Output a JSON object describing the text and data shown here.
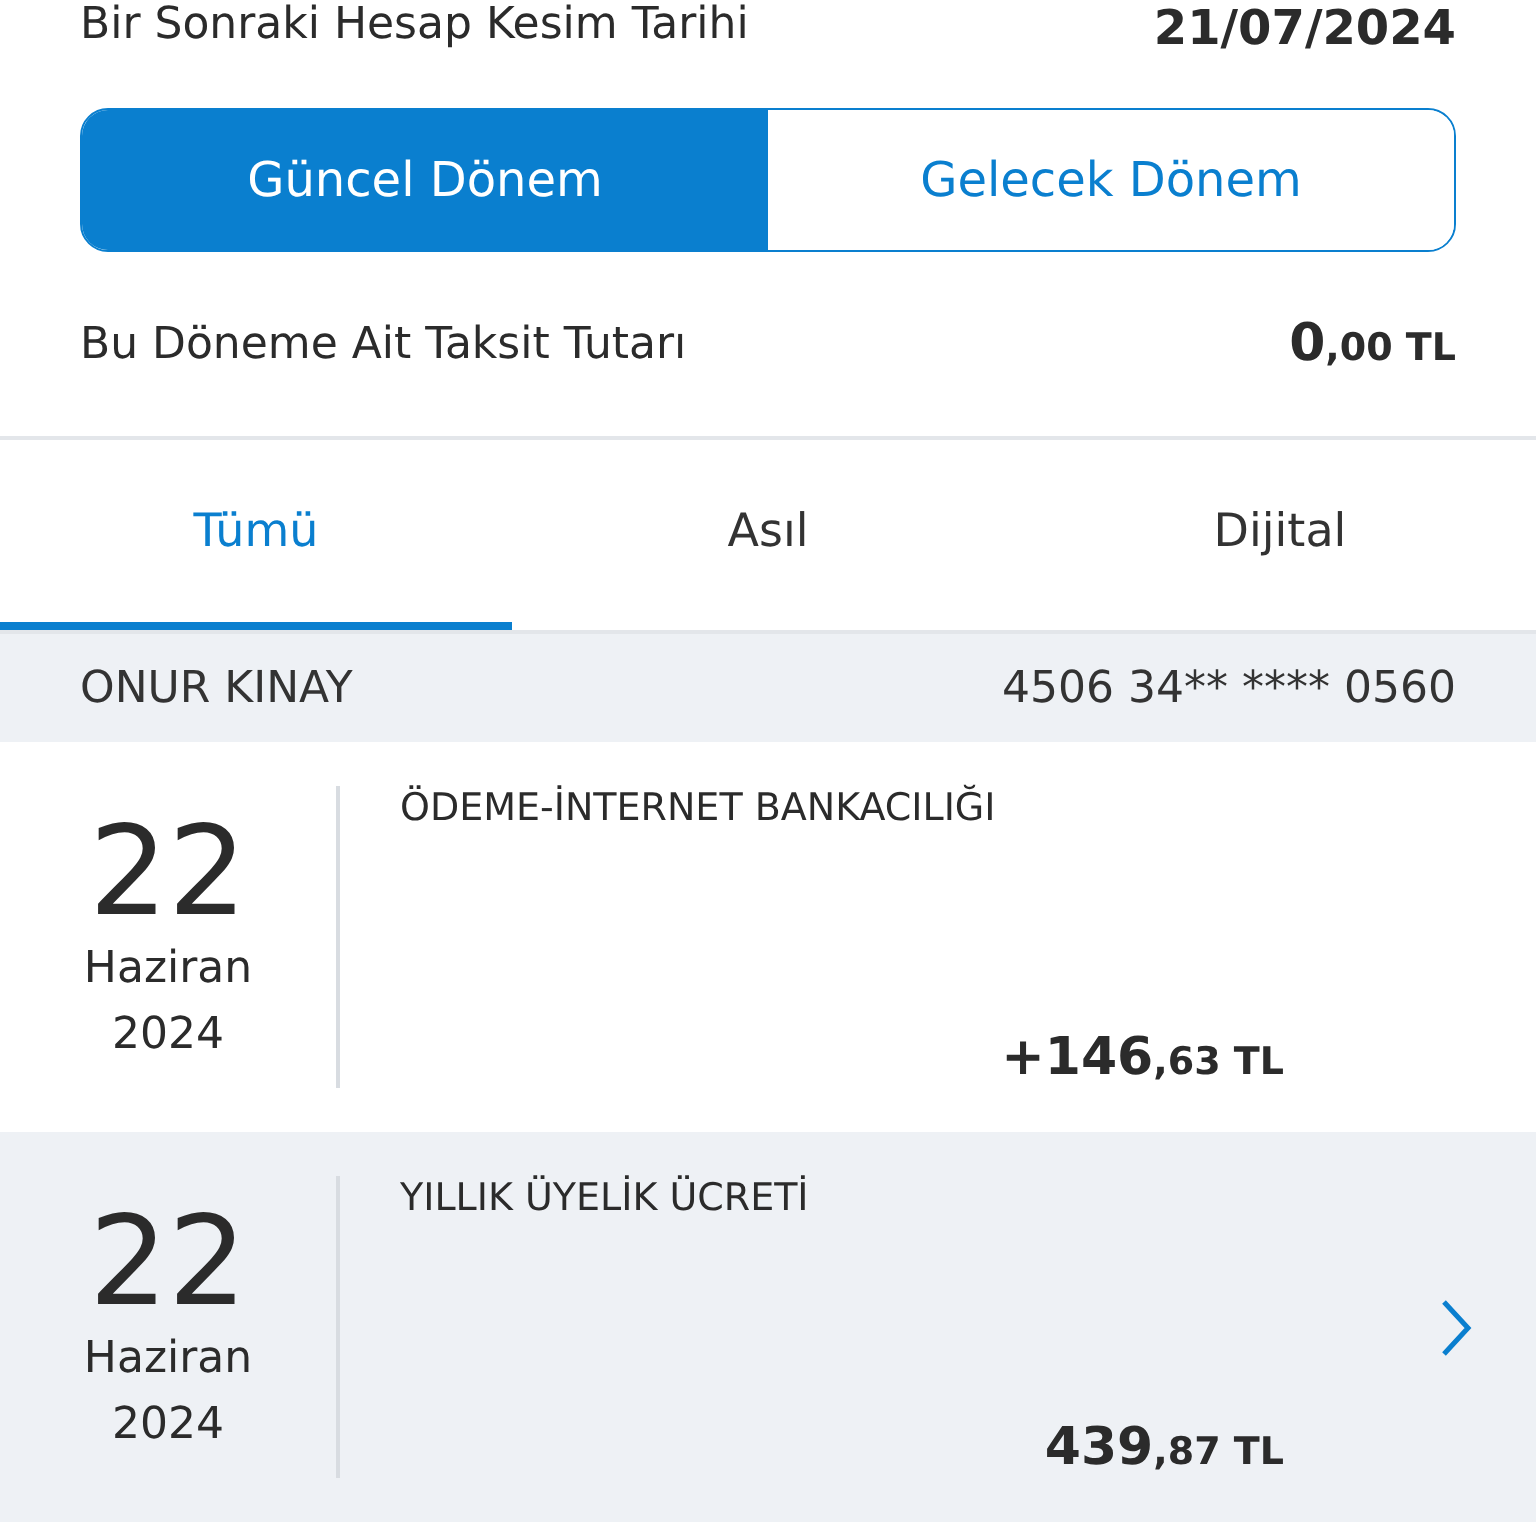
{
  "statement_date": {
    "label": "Bir Sonraki Hesap Kesim Tarihi",
    "value": "21/07/2024"
  },
  "period_tabs": [
    {
      "label": "Güncel Dönem",
      "selected": true
    },
    {
      "label": "Gelecek Dönem",
      "selected": false
    }
  ],
  "installment": {
    "label": "Bu Döneme Ait Taksit Tutarı",
    "amount_main": "0",
    "amount_rest": ",00 TL"
  },
  "tabs": [
    {
      "label": "Tümü",
      "selected": true
    },
    {
      "label": "Asıl",
      "selected": false
    },
    {
      "label": "Dijital",
      "selected": false
    }
  ],
  "card": {
    "holder": "ONUR KINAY",
    "number": "4506 34** **** 0560"
  },
  "transactions": [
    {
      "day": "22",
      "month": "Haziran",
      "year": "2024",
      "title": "ÖDEME-İNTERNET BANKACILIĞI",
      "amount_main": "+146",
      "amount_rest": ",63 TL",
      "highlighted": false,
      "chevron": false
    },
    {
      "day": "22",
      "month": "Haziran",
      "year": "2024",
      "title": "YILLIK ÜYELİK ÜCRETİ",
      "amount_main": "439",
      "amount_rest": ",87 TL",
      "highlighted": true,
      "chevron": true
    }
  ]
}
